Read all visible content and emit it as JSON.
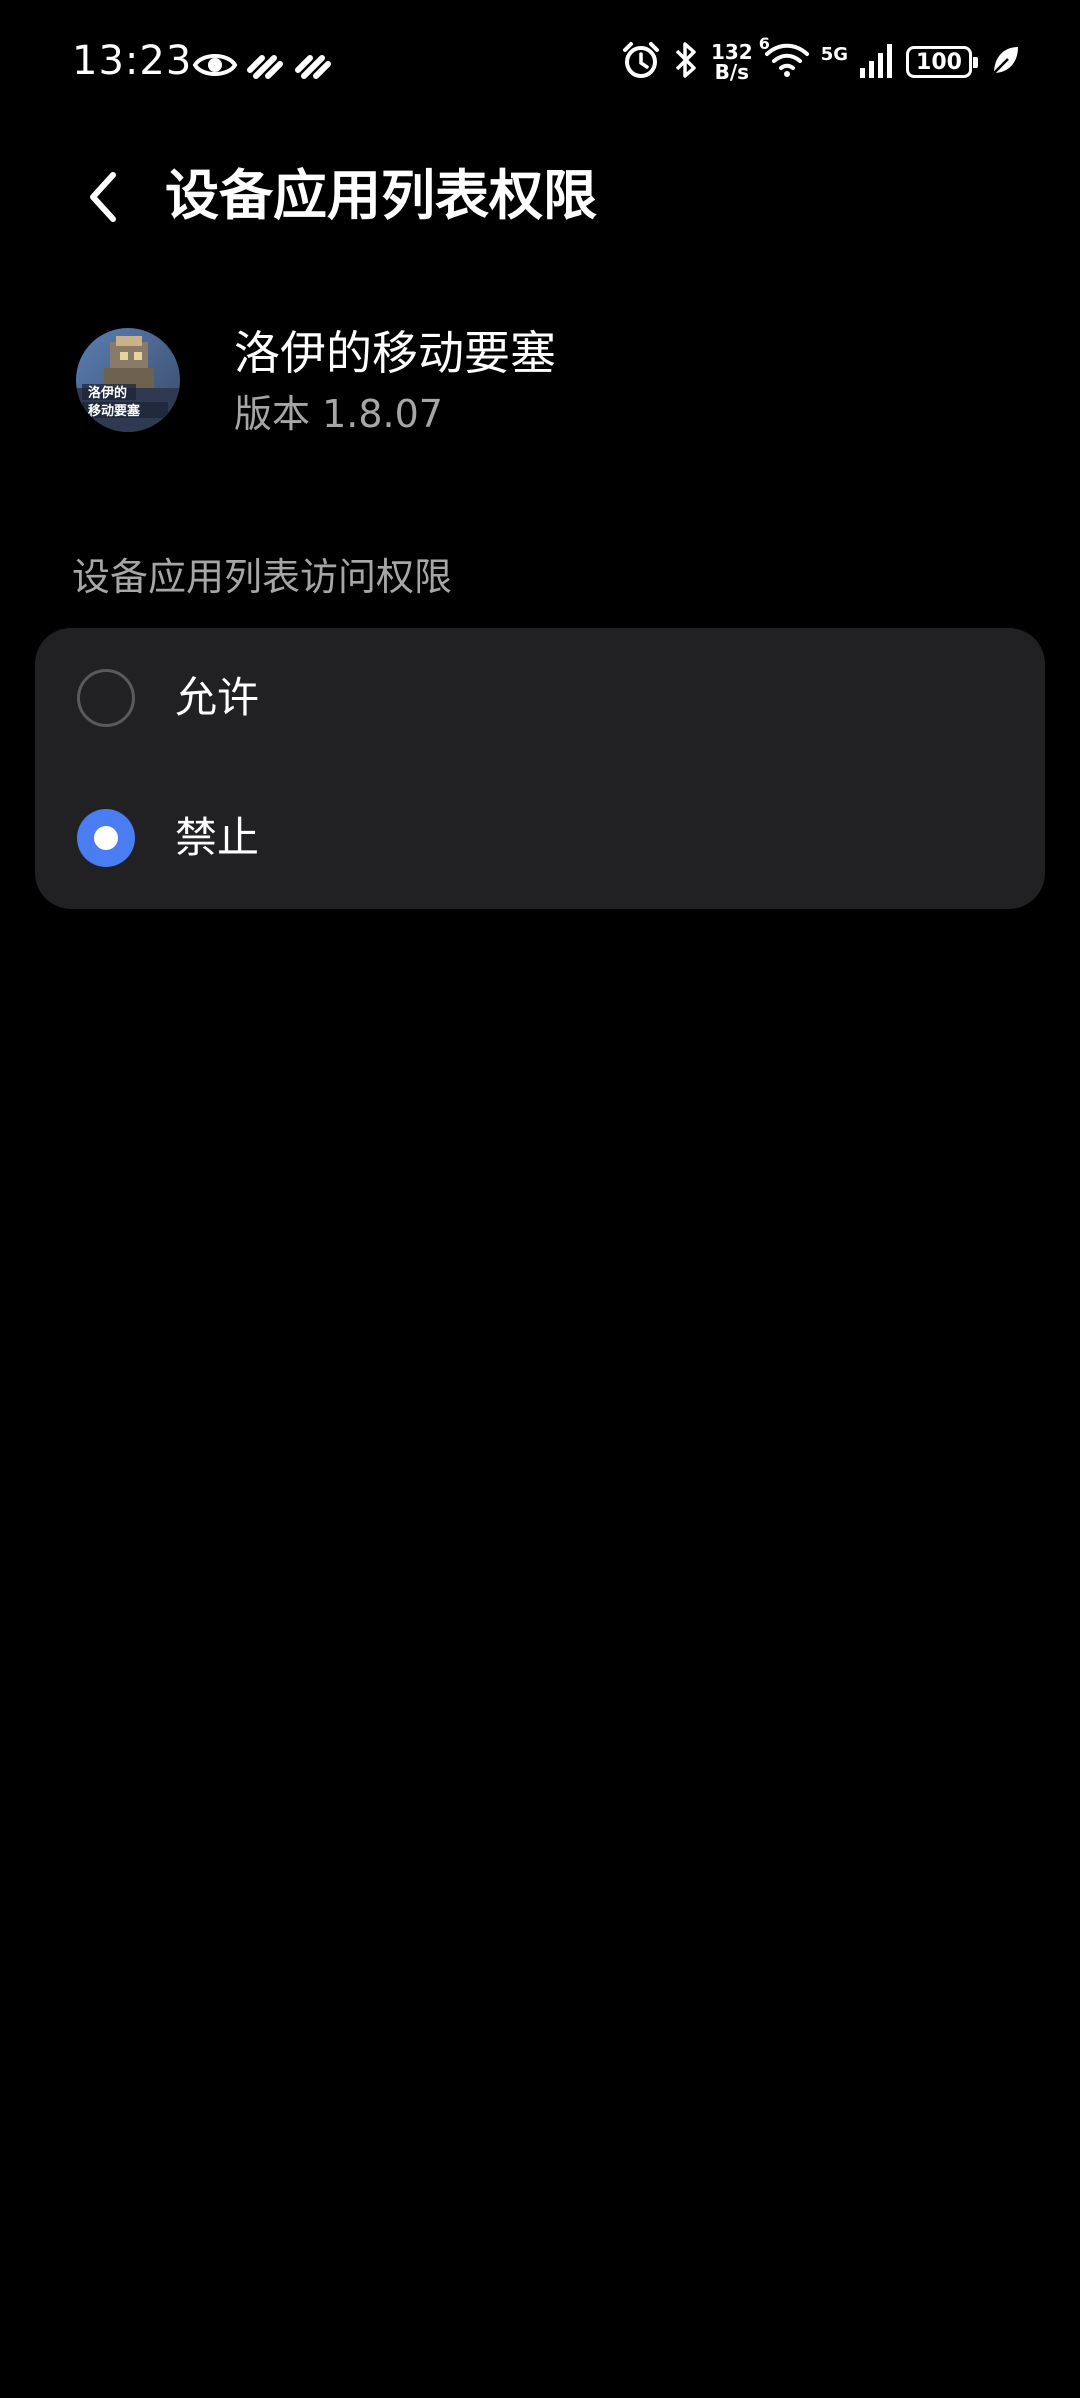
{
  "status_bar": {
    "time": "13:23",
    "net_speed_value": "132",
    "net_speed_unit": "B/s",
    "network": "5G",
    "wifi_badge": "6",
    "battery": "100",
    "icons": [
      "eye-icon",
      "link-icon",
      "link-icon",
      "alarm-icon",
      "bluetooth-icon",
      "wifi-icon",
      "signal-icon",
      "battery-icon",
      "leaf-icon"
    ]
  },
  "header": {
    "title": "设备应用列表权限"
  },
  "app": {
    "name": "洛伊的移动要塞",
    "version_label": "版本 1.8.07"
  },
  "section": {
    "label": "设备应用列表访问权限"
  },
  "options": [
    {
      "label": "允许",
      "selected": false
    },
    {
      "label": "禁止",
      "selected": true
    }
  ],
  "colors": {
    "background": "#000000",
    "card": "#212123",
    "accent": "#4a7df2",
    "secondary_text": "#a6a6a6"
  }
}
